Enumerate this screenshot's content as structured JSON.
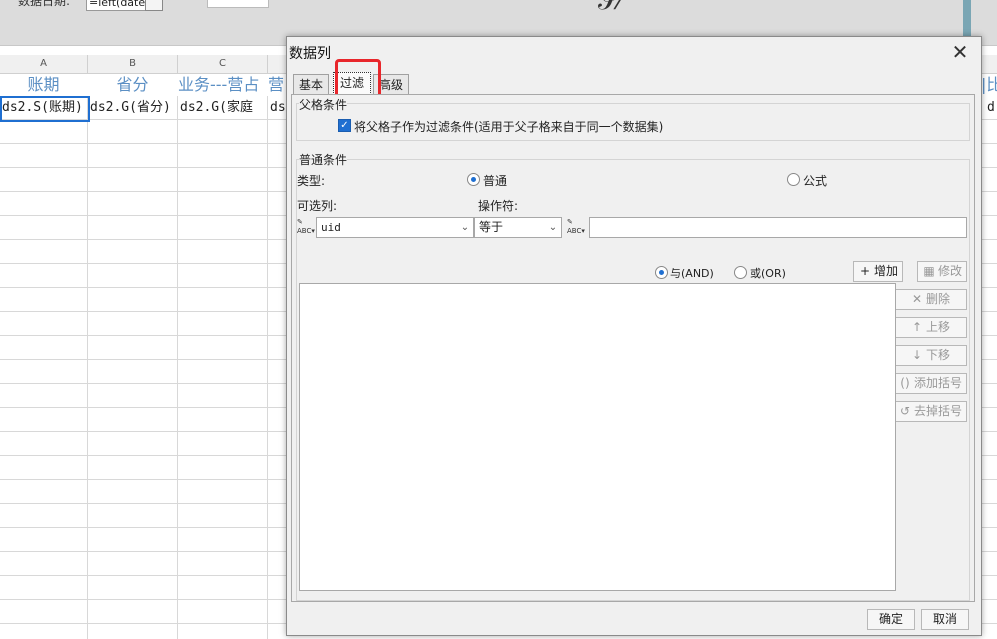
{
  "background": {
    "date_label": "数据日期:",
    "date_value": "=left(date",
    "col_letters": [
      "A",
      "B",
      "C"
    ],
    "headers": [
      "账期",
      "省分",
      "业务---营占",
      "营占比-"
    ],
    "cells": [
      "ds2.S(账期)",
      "ds2.G(省分)",
      "ds2.G(家庭",
      "ds"
    ],
    "right_headers": [
      "|",
      "|比"
    ],
    "right_cell": "d"
  },
  "dialog": {
    "title": "数据列",
    "close_glyph": "✕",
    "tabs": [
      "基本",
      "过滤",
      "高级"
    ],
    "active_tab": "过滤",
    "parent_section": {
      "legend": "父格条件",
      "checkbox_label": "将父格子作为过滤条件(适用于父子格来自于同一个数据集)",
      "checked": true
    },
    "normal_section": {
      "legend": "普通条件",
      "type_label": "类型:",
      "type_options": [
        "普通",
        "公式"
      ],
      "type_selected": "普通",
      "column_label": "可选列:",
      "operator_label": "操作符:",
      "column_value": "uid",
      "operator_value": "等于",
      "value_input": "",
      "logic_options": [
        "与(AND)",
        "或(OR)"
      ],
      "logic_selected": "与(AND)",
      "add_button": "增加",
      "modify_button": "修改",
      "side_buttons": [
        "删除",
        "上移",
        "下移",
        "添加括号",
        "去掉括号"
      ]
    },
    "ok_button": "确定",
    "cancel_button": "取消"
  },
  "colors": {
    "accent": "#1f6fd1",
    "highlight": "#e8262b",
    "header_text": "#5b8fc4"
  }
}
